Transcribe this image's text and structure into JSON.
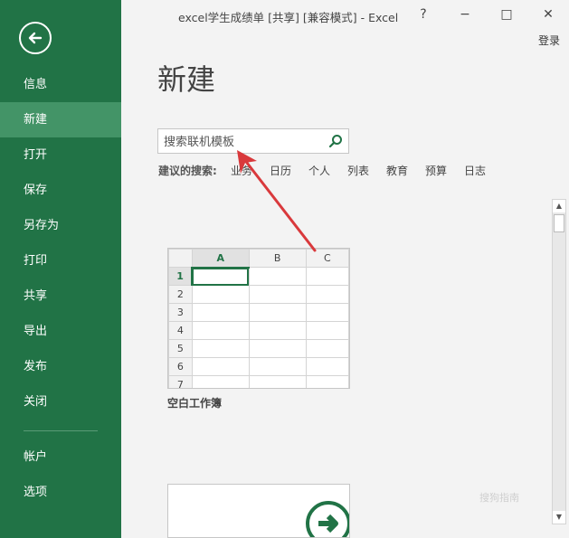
{
  "window": {
    "title": "excel学生成绩单  [共享]  [兼容模式] - Excel",
    "help": "?",
    "minimize": "−",
    "restore": "□",
    "close": "✕",
    "login": "登录"
  },
  "sidebar": {
    "items": [
      {
        "label": "信息"
      },
      {
        "label": "新建"
      },
      {
        "label": "打开"
      },
      {
        "label": "保存"
      },
      {
        "label": "另存为"
      },
      {
        "label": "打印"
      },
      {
        "label": "共享"
      },
      {
        "label": "导出"
      },
      {
        "label": "发布"
      },
      {
        "label": "关闭"
      },
      {
        "label": "帐户"
      },
      {
        "label": "选项"
      }
    ],
    "active_index": 1
  },
  "main": {
    "title": "新建",
    "search": {
      "placeholder": "搜索联机模板",
      "value": ""
    },
    "suggest_label": "建议的搜索:",
    "suggestions": [
      "业务",
      "日历",
      "个人",
      "列表",
      "教育",
      "预算",
      "日志"
    ]
  },
  "template": {
    "columns": [
      "A",
      "B",
      "C"
    ],
    "rows": [
      "1",
      "2",
      "3",
      "4",
      "5",
      "6",
      "7"
    ],
    "caption": "空白工作簿"
  },
  "watermark": "搜狗指南",
  "colors": {
    "accent": "#217346",
    "active": "#439467",
    "arrow": "#d9393c"
  }
}
